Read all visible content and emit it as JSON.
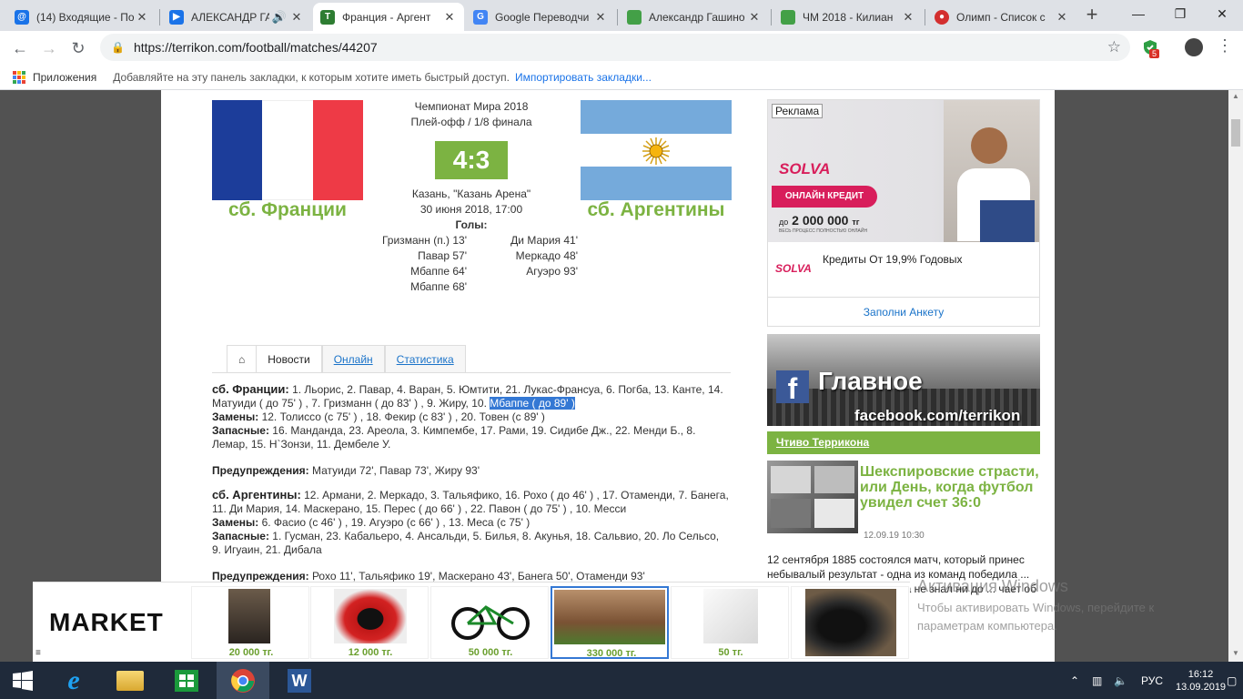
{
  "browser": {
    "tabs": [
      {
        "title": "(14) Входящие - По",
        "color": "#1a73e8",
        "glyph": "@"
      },
      {
        "title": "АЛЕКСАНДР ГА",
        "color": "#1a73e8",
        "glyph": "▶"
      },
      {
        "title": "Франция - Аргент",
        "color": "#2e7d32",
        "glyph": "T"
      },
      {
        "title": "Google Переводчи",
        "color": "#4285f4",
        "glyph": "G"
      },
      {
        "title": "Александр Гашино",
        "color": "#43a047",
        "glyph": ""
      },
      {
        "title": "ЧМ 2018 - Килиан",
        "color": "#43a047",
        "glyph": ""
      },
      {
        "title": "Олимп - Список с",
        "color": "#d32f2f",
        "glyph": "●"
      }
    ],
    "new_tab": "+",
    "url": "https://terrikon.com/football/matches/44207",
    "extension_badge": "5",
    "bookmarks": {
      "apps": "Приложения",
      "hint": "Добавляйте на эту панель закладки, к которым хотите иметь быстрый доступ.",
      "import": "Импортировать закладки..."
    }
  },
  "match": {
    "home": "сб. Франции",
    "away": "сб. Аргентины",
    "competition": "Чемпионат Мира 2018",
    "stage": "Плей-офф / 1/8 финала",
    "score": "4:3",
    "venue": "Казань, \"Казань Арена\"",
    "datetime": "30 июня 2018, 17:00",
    "goals_label": "Голы:",
    "home_goals": [
      "Гризманн (п.) 13'",
      "Павар 57'",
      "Мбаппе 64'",
      "Мбаппе 68'"
    ],
    "away_goals": [
      "Ди Мария 41'",
      "Меркадо 48'",
      "Агуэро 93'"
    ]
  },
  "page_tabs": {
    "home_icon": "⌂",
    "news": "Новости",
    "online": "Онлайн",
    "stats": "Статистика"
  },
  "lineups": {
    "home_label": "сб. Франции:",
    "home_start": "1. Льорис, 2. Павар, 4. Варан, 5. Юмтити, 21. Лукас-Франсуа, 6. Погба, 13. Канте, 14. Матуиди ( до 75' ) , 7. Гризманн ( до 83' ) , 9. Жиру, 10.",
    "home_start_hl": "Мбаппе ( до 89' )",
    "subs_label": "Замены:",
    "home_subs": "12. Толиссо (с 75' ) , 18. Фекир (с 83' ) , 20. Товен (с 89' )",
    "reserves_label": "Запасные:",
    "home_reserves": "16. Манданда, 23. Ареола, 3. Кимпембе, 17. Рами, 19. Сидибе Дж., 22. Менди Б., 8. Лемар, 15. Н`Зонзи, 11. Дембеле У.",
    "warnings_label": "Предупреждения:",
    "home_warnings": "Матуиди 72', Павар 73', Жиру 93'",
    "away_label": "сб. Аргентины:",
    "away_start": "12. Армани, 2. Меркадо, 3. Тальяфико, 16. Рохо ( до 46' ) , 17. Отаменди, 7. Банега, 11. Ди Мария, 14. Маскерано, 15. Перес ( до 66' ) , 22. Павон ( до 75' ) , 10. Месси",
    "away_subs": "6. Фасио (с 46' ) , 19. Агуэро (с 66' ) , 13. Меса (с 75' )",
    "away_reserves": "1. Гусман, 23. Кабальеро, 4. Ансальди, 5. Билья, 8. Акунья, 18. Сальвио, 20. Ло Сельсо, 9. Игуаин, 21. Дибала",
    "away_warnings": "Рохо 11', Тальяфико 19', Маскерано 43', Банега 50', Отаменди 93'"
  },
  "sidebar": {
    "ad_label": "Реклама",
    "ad_brand": "SOLVA",
    "ad_credit": "ОНЛАЙН КРЕДИТ",
    "ad_prefix": "до",
    "ad_amount": "2 000 000",
    "ad_currency": "тг",
    "ad_note": "ВЕСЬ ПРОЦЕСС ПОЛНОСТЬЮ ОНЛАЙН",
    "ad_text": "Кредиты От 19,9% Годовых",
    "ad_cta": "Заполни Анкету",
    "fb_title": "Главное",
    "fb_url": "facebook.com/terrikon",
    "section": "Чтиво Терриконa",
    "article_title": "Шекспировские страсти, или День, когда футбол увидел счет 36:0",
    "article_date": "12.09.19 10:30",
    "article_text": "12 сентября 1885 состоялся матч, который принес небывалый результат - одна из команд победила ... крупного результата никогда не знал ни до ... чает об этом"
  },
  "market": {
    "logo": "MARKET",
    "items": [
      {
        "price": "20 000 тг."
      },
      {
        "price": "12 000 тг."
      },
      {
        "price": "50 000 тг."
      },
      {
        "price": "330 000 тг."
      },
      {
        "price": "50 тг."
      },
      {
        "price": ""
      }
    ]
  },
  "watermark": {
    "title": "Активация Windows",
    "line1": "Чтобы активировать Windows, перейдите к",
    "line2": "параметрам компьютера."
  },
  "taskbar": {
    "lang": "РУС",
    "time": "16:12",
    "date": "13.09.2019"
  }
}
